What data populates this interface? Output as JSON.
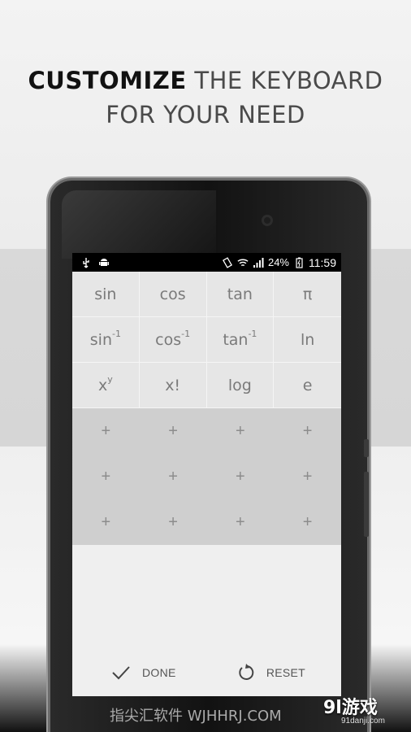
{
  "headline": {
    "strong": "CUSTOMIZE",
    "rest": " THE KEYBOARD",
    "line2": "FOR YOUR NEED"
  },
  "statusbar": {
    "battery_percent": "24%",
    "time": "11:59"
  },
  "keyboard": {
    "functions": [
      {
        "base": "sin",
        "sup": ""
      },
      {
        "base": "cos",
        "sup": ""
      },
      {
        "base": "tan",
        "sup": ""
      },
      {
        "base": "π",
        "sup": ""
      },
      {
        "base": "sin",
        "sup": "-1"
      },
      {
        "base": "cos",
        "sup": "-1"
      },
      {
        "base": "tan",
        "sup": "-1"
      },
      {
        "base": "ln",
        "sup": ""
      },
      {
        "base": "x",
        "sup": "y"
      },
      {
        "base": "x!",
        "sup": ""
      },
      {
        "base": "log",
        "sup": ""
      },
      {
        "base": "e",
        "sup": ""
      }
    ],
    "add_slot_symbol": "+"
  },
  "actions": {
    "done_label": "DONE",
    "reset_label": "RESET"
  },
  "watermark": {
    "text": "指尖汇软件 WJHHRJ.COM",
    "logo": "9l游戏",
    "logo_sub": "91danji.com"
  }
}
